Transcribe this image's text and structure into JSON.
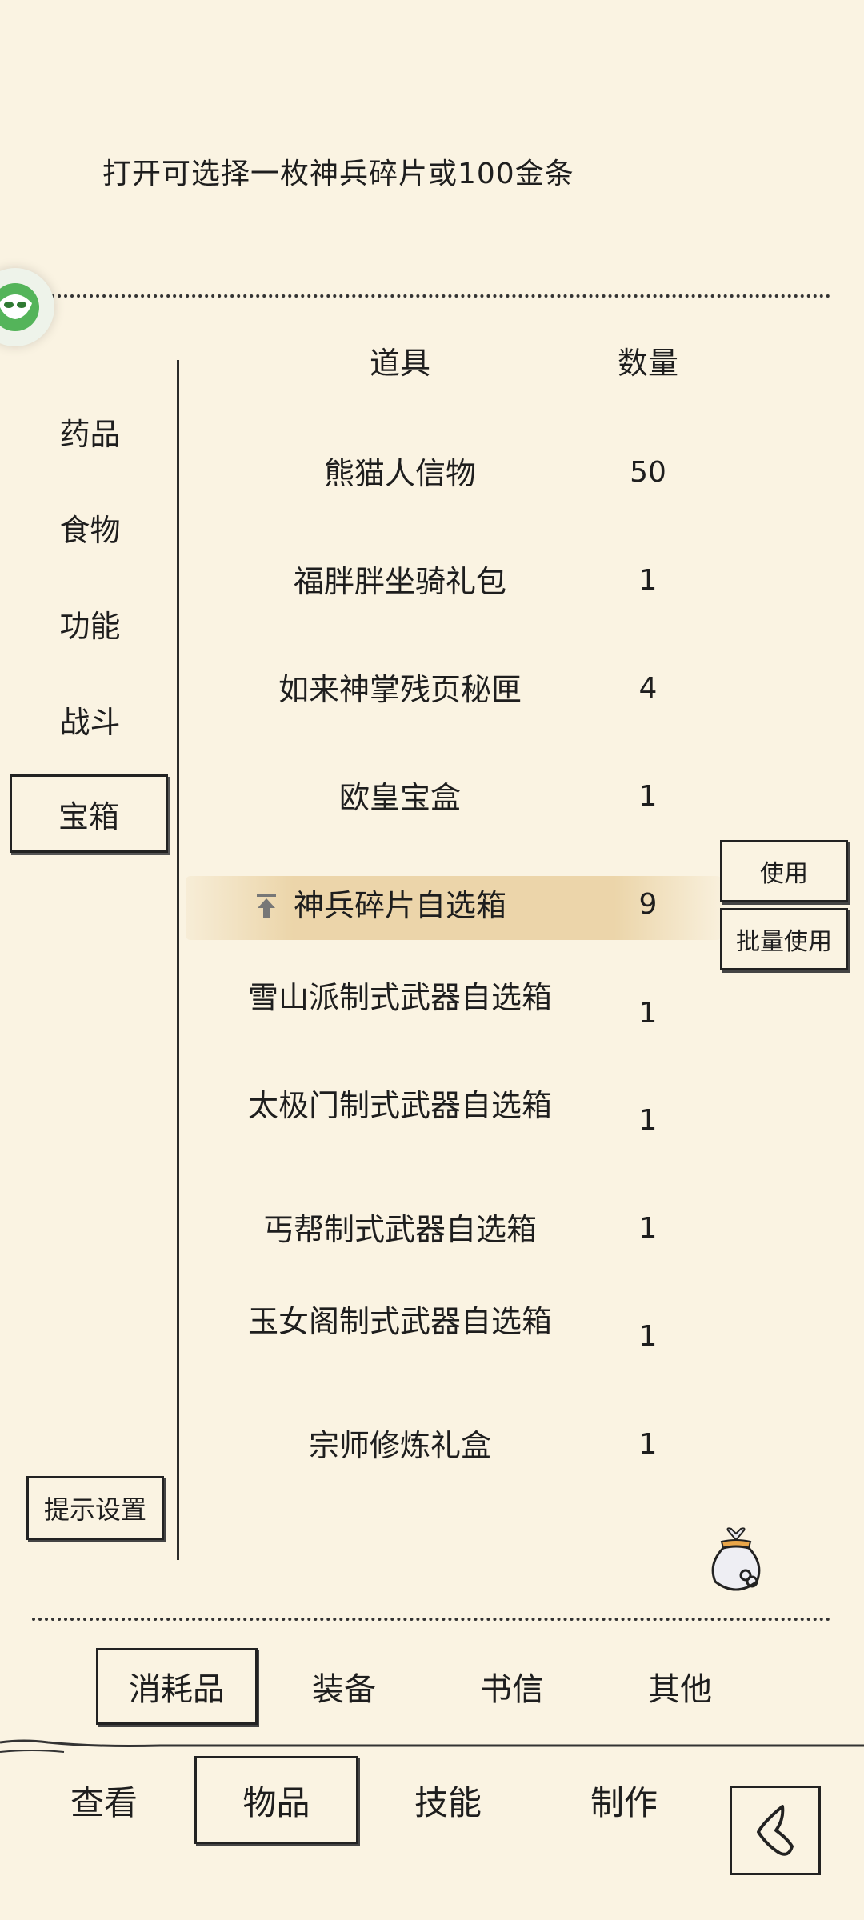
{
  "item_description": "打开可选择一枚神兵碎片或100金条",
  "table": {
    "header_item": "道具",
    "header_qty": "数量",
    "rows": [
      {
        "name": "熊猫人信物",
        "qty": "50"
      },
      {
        "name": "福胖胖坐骑礼包",
        "qty": "1"
      },
      {
        "name": "如来神掌残页秘匣",
        "qty": "4"
      },
      {
        "name": "欧皇宝盒",
        "qty": "1"
      },
      {
        "name": "神兵碎片自选箱",
        "qty": "9"
      },
      {
        "name": "雪山派制式武器自选箱",
        "qty": "1"
      },
      {
        "name": "太极门制式武器自选箱",
        "qty": "1"
      },
      {
        "name": "丐帮制式武器自选箱",
        "qty": "1"
      },
      {
        "name": "玉女阁制式武器自选箱",
        "qty": "1"
      },
      {
        "name": "宗师修炼礼盒",
        "qty": "1"
      }
    ]
  },
  "categories": [
    "药品",
    "食物",
    "功能",
    "战斗",
    "宝箱"
  ],
  "selected_category": "宝箱",
  "actions": {
    "use": "使用",
    "batch_use": "批量使用"
  },
  "tip_settings": "提示设置",
  "sub_tabs": [
    "消耗品",
    "装备",
    "书信",
    "其他"
  ],
  "bottom_nav": [
    "查看",
    "物品",
    "技能",
    "制作"
  ],
  "icons": {
    "float_ball": "floating-assistant-icon",
    "selected_arrow": "upgrade-arrow-icon",
    "bag": "money-bag-icon",
    "back": "back-arrow-icon"
  },
  "colors": {
    "background": "#faf3e2",
    "highlight": "#e9d0a0",
    "ink": "#1e1e1e"
  }
}
